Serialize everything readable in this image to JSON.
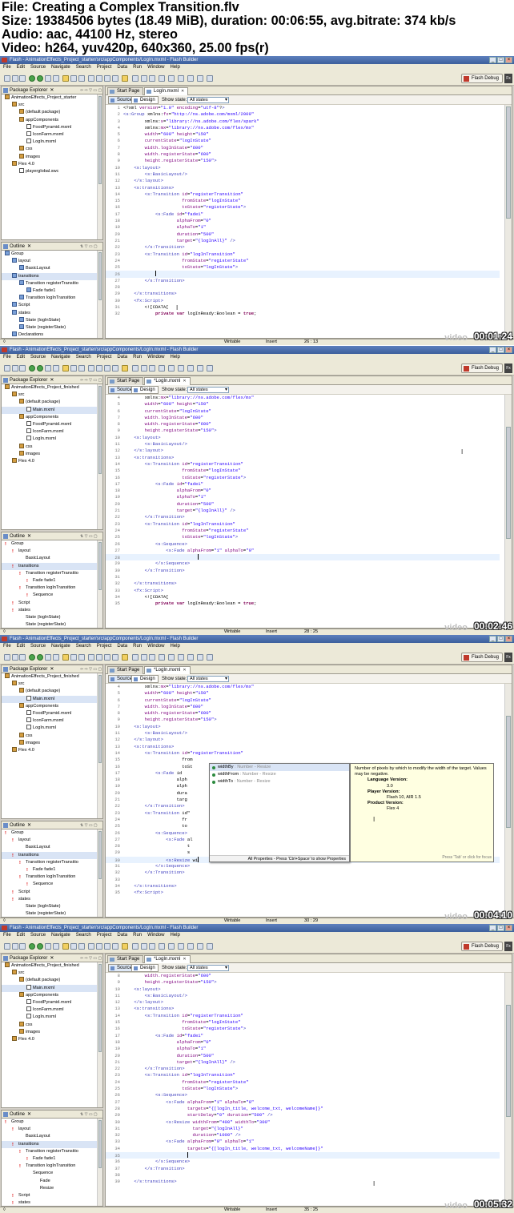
{
  "header": {
    "line1": "File: Creating a Complex Transition.flv",
    "line2": "Size: 19384506 bytes (18.49 MiB), duration: 00:06:55, avg.bitrate: 374 kb/s",
    "line3": "Audio: aac, 44100 Hz, stereo",
    "line4": "Video: h264, yuv420p, 640x360, 25.00 fps(r)"
  },
  "watermark": "video",
  "frames": [
    {
      "title": "Flash - AnimationEffects_Project_starter/src/appComponents/LogIn.mxml - Flash Builder",
      "timestamp": "00:01:24",
      "cursor_pos": "26 : 13",
      "tab_label": "LogIn.mxml",
      "project_name": "AnimationEffects_Project_starter",
      "status_writable": "Writable",
      "status_insert": "Insert"
    },
    {
      "title": "Flash - AnimationEffects_Project_starter/src/appComponents/LogIn.mxml - Flash Builder",
      "timestamp": "00:02:46",
      "cursor_pos": "28 : 25",
      "tab_label": "*LogIn.mxml",
      "project_name": "AnimationEffects_Project_finished",
      "status_writable": "Writable",
      "status_insert": "Insert"
    },
    {
      "title": "Flash - AnimationEffects_Project_starter/src/appComponents/LogIn.mxml - Flash Builder",
      "timestamp": "00:04:10",
      "cursor_pos": "30 : 29",
      "tab_label": "*LogIn.mxml",
      "project_name": "AnimationEffects_Project_finished",
      "status_writable": "Writable",
      "status_insert": "Insert"
    },
    {
      "title": "Flash - AnimationEffects_Project_starter/src/appComponents/LogIn.mxml - Flash Builder",
      "timestamp": "00:05:32",
      "cursor_pos": "35 : 25",
      "tab_label": "*LogIn.mxml",
      "project_name": "AnimationEffects_Project_finished",
      "status_writable": "Writable",
      "status_insert": "Insert"
    }
  ],
  "menu": [
    "File",
    "Edit",
    "Source",
    "Navigate",
    "Search",
    "Project",
    "Data",
    "Run",
    "Window",
    "Help"
  ],
  "perspective_label": "Flash Debug",
  "fx_label": "Fx",
  "start_page_tab": "Start Page",
  "package_explorer_title": "Package Explorer",
  "outline_title": "Outline",
  "source_label": "Source",
  "design_label": "Design",
  "show_state_label": "Show state:",
  "state_value": "All states",
  "assist": {
    "items": [
      {
        "name": "widthBy",
        "type": " : Number - Resize"
      },
      {
        "name": "widthFrom",
        "type": " : Number - Resize"
      },
      {
        "name": "widthTo",
        "type": " : Number - Resize"
      }
    ],
    "footer": "All Properties - Press 'Ctrl+Space' to show Properties"
  },
  "doc": {
    "text": "Number of pixels by which to modify the width of the target. Values may be negative.",
    "lang_label": "Language Version:",
    "lang_value": "3.0",
    "player_label": "Player Version:",
    "player_value": "Flash 10, AIR 1.5",
    "product_label": "Product Version:",
    "product_value": "Flex 4",
    "footer": "Press 'Tab' or click for focus"
  }
}
